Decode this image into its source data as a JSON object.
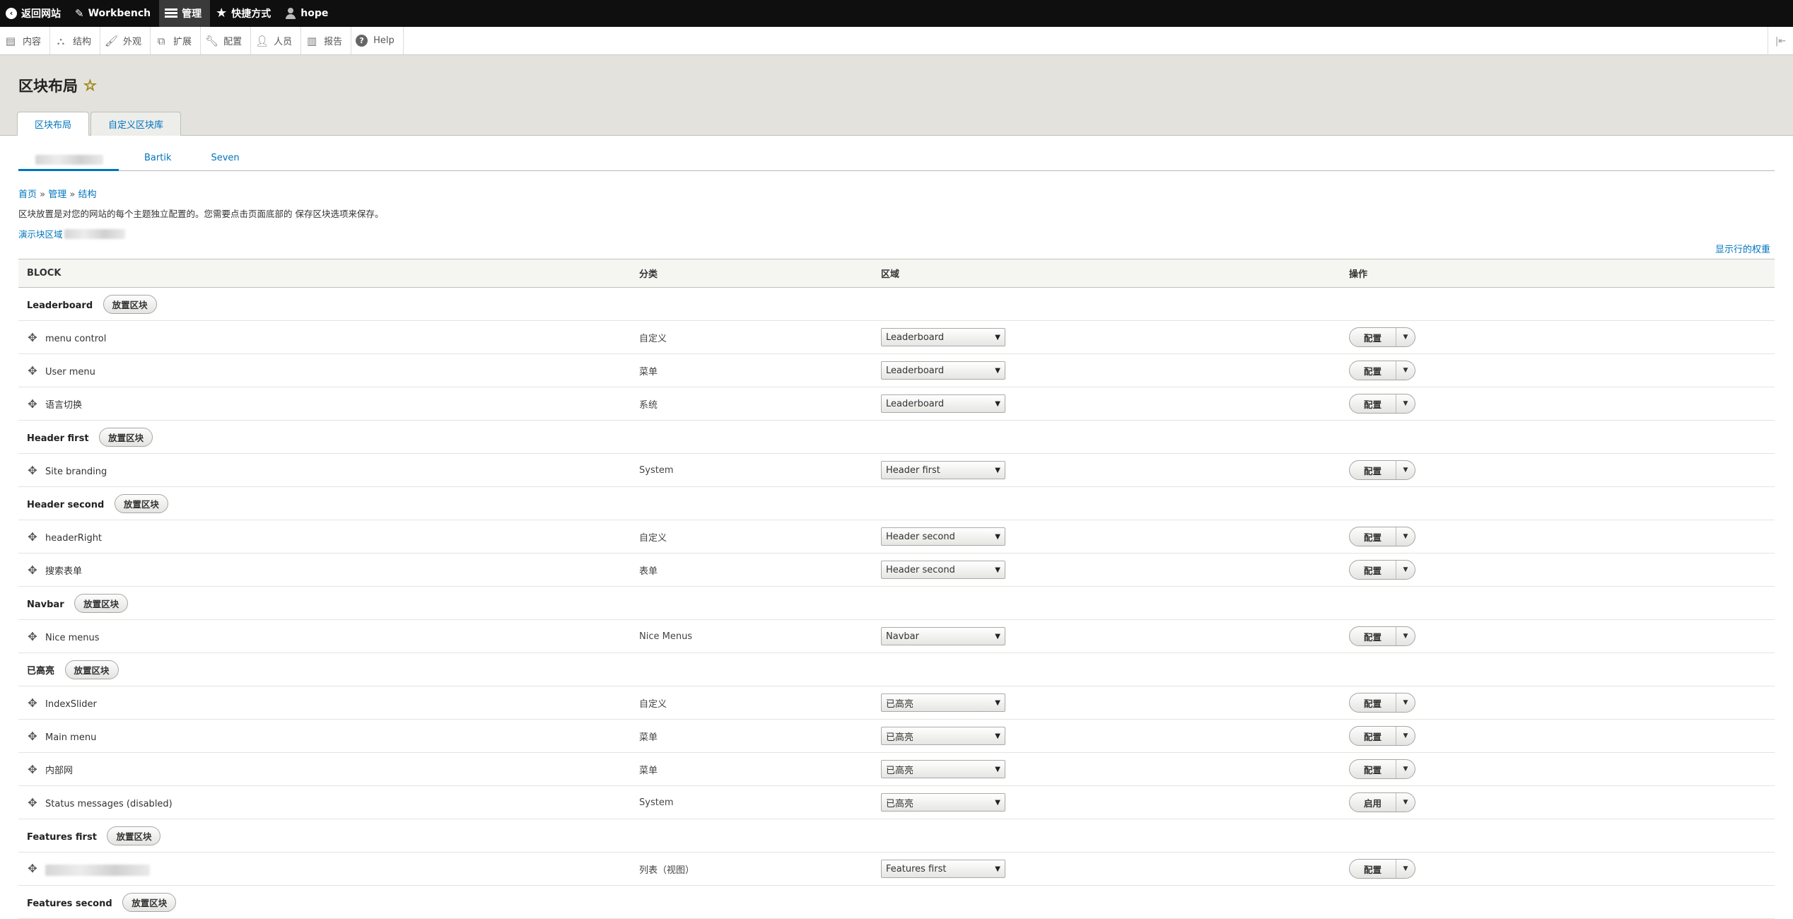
{
  "toolbar": {
    "back_label": "返回网站",
    "workbench_label": "Workbench",
    "manage_label": "管理",
    "shortcuts_label": "快捷方式",
    "user_label": "hope"
  },
  "tray": {
    "items": [
      "内容",
      "结构",
      "外观",
      "扩展",
      "配置",
      "人员",
      "报告",
      "Help"
    ]
  },
  "page": {
    "title": "区块布局",
    "tabs": [
      "区块布局",
      "自定义区块库"
    ]
  },
  "themes": {
    "tabs": [
      "Bartik",
      "Seven"
    ]
  },
  "breadcrumb": {
    "home": "首页",
    "admin": "管理",
    "structure": "结构",
    "sep": "»"
  },
  "description": "区块放置是对您的网站的每个主题独立配置的。您需要点击页面底部的 保存区块选项来保存。",
  "demo_link": "演示块区域",
  "weights_link": "显示行的权重",
  "table": {
    "headers": [
      "BLOCK",
      "分类",
      "区域",
      "操作"
    ],
    "place_label": "放置区块",
    "configure_label": "配置",
    "enable_label": "启用",
    "regions": [
      {
        "name": "Leaderboard",
        "blocks": [
          {
            "name": "menu control",
            "category": "自定义",
            "region": "Leaderboard",
            "op": "配置"
          },
          {
            "name": "User menu",
            "category": "菜单",
            "region": "Leaderboard",
            "op": "配置"
          },
          {
            "name": "语言切换",
            "category": "系统",
            "region": "Leaderboard",
            "op": "配置"
          }
        ]
      },
      {
        "name": "Header first",
        "blocks": [
          {
            "name": "Site branding",
            "category": "System",
            "region": "Header first",
            "op": "配置"
          }
        ]
      },
      {
        "name": "Header second",
        "blocks": [
          {
            "name": "headerRight",
            "category": "自定义",
            "region": "Header second",
            "op": "配置"
          },
          {
            "name": "搜索表单",
            "category": "表单",
            "region": "Header second",
            "op": "配置"
          }
        ]
      },
      {
        "name": "Navbar",
        "blocks": [
          {
            "name": "Nice menus",
            "category": "Nice Menus",
            "region": "Navbar",
            "op": "配置"
          }
        ]
      },
      {
        "name": "已高亮",
        "blocks": [
          {
            "name": "IndexSlider",
            "category": "自定义",
            "region": "已高亮",
            "op": "配置"
          },
          {
            "name": "Main menu",
            "category": "菜单",
            "region": "已高亮",
            "op": "配置"
          },
          {
            "name": "内部网",
            "category": "菜单",
            "region": "已高亮",
            "op": "配置"
          },
          {
            "name": "Status messages (disabled)",
            "category": "System",
            "region": "已高亮",
            "op": "启用"
          }
        ]
      },
      {
        "name": "Features first",
        "blocks": [
          {
            "name": "",
            "category": "列表（视图）",
            "region": "Features first",
            "op": "配置"
          }
        ]
      },
      {
        "name": "Features second",
        "blocks": []
      }
    ]
  }
}
